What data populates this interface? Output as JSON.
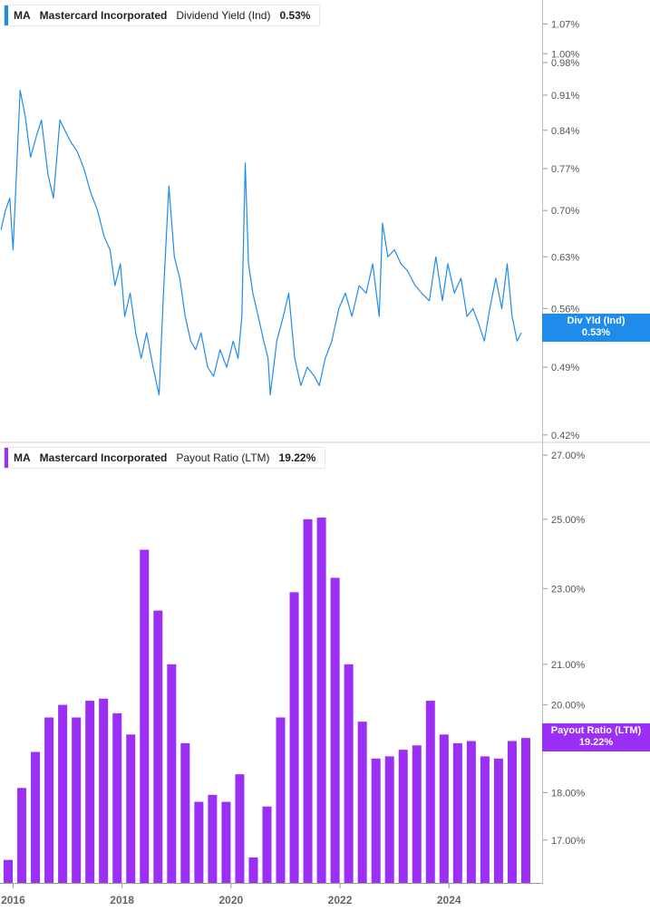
{
  "legends": [
    {
      "ticker": "MA",
      "company": "Mastercard Incorporated",
      "metric": "Dividend Yield (Ind)",
      "value": "0.53%",
      "color": "#1f8ceb"
    },
    {
      "ticker": "MA",
      "company": "Mastercard Incorporated",
      "metric": "Payout Ratio (LTM)",
      "value": "19.22%",
      "color": "#9b2ff5"
    }
  ],
  "tags": [
    {
      "label": "Div Yld (Ind)",
      "value": "0.53%",
      "color": "#1f8ceb"
    },
    {
      "label": "Payout Ratio (LTM)",
      "value": "19.22%",
      "color": "#9b2ff5"
    }
  ],
  "chart_data": [
    {
      "type": "line",
      "name": "Dividend Yield (Ind)",
      "color": "#1f8ceb",
      "scale": "log",
      "ylim": [
        0.413,
        1.13
      ],
      "xlim": [
        2015.76,
        2025.71
      ],
      "y_ticks": [
        "1.07%",
        "1.00%",
        "0.98%",
        "0.91%",
        "0.84%",
        "0.77%",
        "0.70%",
        "0.63%",
        "0.56%",
        "0.49%",
        "0.42%"
      ],
      "y_tick_values": [
        1.07,
        1.0,
        0.98,
        0.91,
        0.84,
        0.77,
        0.7,
        0.63,
        0.56,
        0.49,
        0.42
      ],
      "points": [
        [
          2015.78,
          0.67
        ],
        [
          2015.86,
          0.7
        ],
        [
          2015.94,
          0.72
        ],
        [
          2016.0,
          0.64
        ],
        [
          2016.08,
          0.8
        ],
        [
          2016.13,
          0.92
        ],
        [
          2016.22,
          0.87
        ],
        [
          2016.32,
          0.79
        ],
        [
          2016.43,
          0.83
        ],
        [
          2016.52,
          0.86
        ],
        [
          2016.64,
          0.76
        ],
        [
          2016.74,
          0.72
        ],
        [
          2016.86,
          0.86
        ],
        [
          2016.95,
          0.84
        ],
        [
          2017.05,
          0.82
        ],
        [
          2017.18,
          0.8
        ],
        [
          2017.3,
          0.77
        ],
        [
          2017.42,
          0.73
        ],
        [
          2017.55,
          0.7
        ],
        [
          2017.67,
          0.66
        ],
        [
          2017.78,
          0.64
        ],
        [
          2017.87,
          0.59
        ],
        [
          2017.97,
          0.62
        ],
        [
          2018.05,
          0.55
        ],
        [
          2018.15,
          0.58
        ],
        [
          2018.25,
          0.53
        ],
        [
          2018.35,
          0.5
        ],
        [
          2018.45,
          0.53
        ],
        [
          2018.57,
          0.49
        ],
        [
          2018.68,
          0.46
        ],
        [
          2018.76,
          0.58
        ],
        [
          2018.86,
          0.74
        ],
        [
          2018.96,
          0.63
        ],
        [
          2019.06,
          0.6
        ],
        [
          2019.16,
          0.55
        ],
        [
          2019.26,
          0.52
        ],
        [
          2019.35,
          0.51
        ],
        [
          2019.45,
          0.53
        ],
        [
          2019.57,
          0.49
        ],
        [
          2019.68,
          0.48
        ],
        [
          2019.8,
          0.51
        ],
        [
          2019.92,
          0.49
        ],
        [
          2020.04,
          0.52
        ],
        [
          2020.13,
          0.5
        ],
        [
          2020.2,
          0.55
        ],
        [
          2020.26,
          0.78
        ],
        [
          2020.32,
          0.62
        ],
        [
          2020.4,
          0.58
        ],
        [
          2020.5,
          0.55
        ],
        [
          2020.6,
          0.52
        ],
        [
          2020.68,
          0.5
        ],
        [
          2020.72,
          0.46
        ],
        [
          2020.84,
          0.52
        ],
        [
          2020.96,
          0.55
        ],
        [
          2021.06,
          0.58
        ],
        [
          2021.17,
          0.5
        ],
        [
          2021.28,
          0.47
        ],
        [
          2021.4,
          0.49
        ],
        [
          2021.53,
          0.48
        ],
        [
          2021.62,
          0.47
        ],
        [
          2021.73,
          0.5
        ],
        [
          2021.85,
          0.52
        ],
        [
          2021.98,
          0.56
        ],
        [
          2022.1,
          0.58
        ],
        [
          2022.22,
          0.55
        ],
        [
          2022.35,
          0.59
        ],
        [
          2022.48,
          0.58
        ],
        [
          2022.6,
          0.62
        ],
        [
          2022.72,
          0.55
        ],
        [
          2022.78,
          0.68
        ],
        [
          2022.88,
          0.63
        ],
        [
          2023.0,
          0.64
        ],
        [
          2023.12,
          0.62
        ],
        [
          2023.24,
          0.61
        ],
        [
          2023.38,
          0.59
        ],
        [
          2023.5,
          0.58
        ],
        [
          2023.64,
          0.57
        ],
        [
          2023.76,
          0.63
        ],
        [
          2023.88,
          0.57
        ],
        [
          2023.98,
          0.62
        ],
        [
          2024.1,
          0.58
        ],
        [
          2024.22,
          0.6
        ],
        [
          2024.33,
          0.55
        ],
        [
          2024.44,
          0.56
        ],
        [
          2024.55,
          0.54
        ],
        [
          2024.65,
          0.52
        ],
        [
          2024.75,
          0.56
        ],
        [
          2024.86,
          0.6
        ],
        [
          2024.97,
          0.56
        ],
        [
          2025.07,
          0.62
        ],
        [
          2025.16,
          0.55
        ],
        [
          2025.25,
          0.52
        ],
        [
          2025.33,
          0.53
        ]
      ]
    },
    {
      "type": "bar",
      "name": "Payout Ratio (LTM)",
      "color": "#9b2ff5",
      "scale": "log",
      "ylim": [
        16.13,
        27.42
      ],
      "xlim": [
        2015.76,
        2025.71
      ],
      "y_ticks": [
        "27.00%",
        "25.00%",
        "23.00%",
        "21.00%",
        "20.00%",
        "19.00%",
        "18.00%",
        "17.00%"
      ],
      "y_tick_values": [
        27,
        25,
        23,
        21,
        20,
        19,
        18,
        17
      ],
      "x": [
        2015.64,
        2015.91,
        2016.16,
        2016.41,
        2016.66,
        2016.91,
        2017.16,
        2017.41,
        2017.66,
        2017.91,
        2018.16,
        2018.41,
        2018.66,
        2018.91,
        2019.16,
        2019.41,
        2019.66,
        2019.91,
        2020.16,
        2020.41,
        2020.66,
        2020.91,
        2021.16,
        2021.41,
        2021.66,
        2021.91,
        2022.16,
        2022.41,
        2022.66,
        2022.91,
        2023.16,
        2023.41,
        2023.66,
        2023.91,
        2024.16,
        2024.41,
        2024.66,
        2024.91,
        2025.16,
        2025.41
      ],
      "values": [
        16.5,
        16.6,
        18.1,
        18.9,
        19.7,
        20.0,
        19.7,
        20.1,
        20.15,
        19.8,
        19.3,
        24.1,
        22.4,
        21.0,
        19.1,
        17.8,
        17.95,
        17.8,
        18.4,
        16.65,
        17.7,
        19.7,
        22.9,
        25.0,
        25.05,
        23.3,
        21.0,
        19.6,
        18.75,
        18.8,
        18.95,
        19.05,
        20.1,
        19.3,
        19.1,
        19.15,
        18.8,
        18.75,
        19.15,
        19.22
      ]
    }
  ],
  "x_axis": {
    "ticks": [
      "2016",
      "2018",
      "2020",
      "2022",
      "2024"
    ],
    "tick_values": [
      2016,
      2018,
      2020,
      2022,
      2024
    ]
  }
}
